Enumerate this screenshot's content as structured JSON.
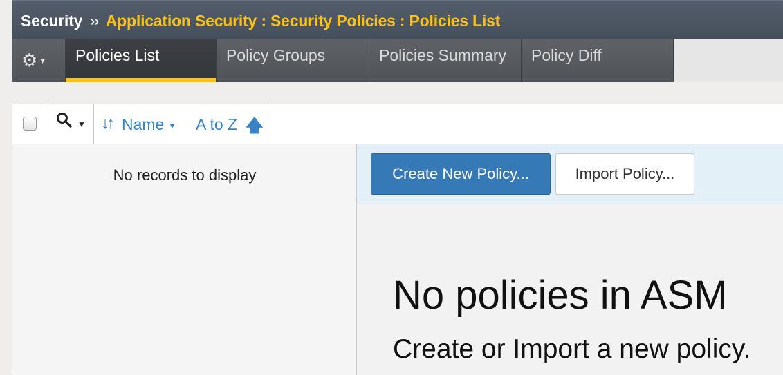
{
  "breadcrumb": {
    "root": "Security",
    "separator": "››",
    "path": "Application Security : Security Policies : Policies List"
  },
  "tabs": [
    {
      "label": "Policies List",
      "active": true
    },
    {
      "label": "Policy Groups",
      "active": false
    },
    {
      "label": "Policies Summary",
      "active": false
    },
    {
      "label": "Policy Diff",
      "active": false
    }
  ],
  "gear_menu": {
    "icon": "gear-icon",
    "caret": "▾"
  },
  "toolbar": {
    "search_icon": "search-icon",
    "sort_field": "Name",
    "sort_order": "A to Z",
    "sort_direction_icon": "arrow-up-icon"
  },
  "list": {
    "empty_message": "No records to display"
  },
  "actions": {
    "create_label": "Create New Policy...",
    "import_label": "Import Policy..."
  },
  "empty_state": {
    "title": "No policies in ASM",
    "subtitle": "Create or Import a new policy."
  },
  "colors": {
    "header_bg": "#4b5563",
    "breadcrumb_accent": "#ffc20e",
    "active_tab_indicator": "#ffc20e",
    "primary_button": "#3679b7",
    "link_blue": "#3b82c4"
  }
}
